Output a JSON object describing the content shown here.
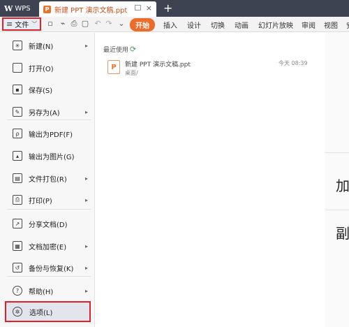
{
  "titlebar": {
    "app_label": "WPS",
    "document_tab": "新建 PPT 演示文稿.ppt",
    "ppt_badge": "P",
    "close": "×",
    "add_tab": "+"
  },
  "toolbar": {
    "file_label": "文件",
    "file_chevron": "﹀",
    "tabs": [
      "开始",
      "插入",
      "设计",
      "切换",
      "动画",
      "幻灯片放映",
      "审阅",
      "视图",
      "安"
    ]
  },
  "file_menu": {
    "items": [
      {
        "label": "新建(N)",
        "icon": "new-file-icon",
        "submenu": true
      },
      {
        "label": "打开(O)",
        "icon": "folder-open-icon",
        "submenu": false
      },
      {
        "label": "保存(S)",
        "icon": "save-icon",
        "submenu": false
      },
      {
        "label": "另存为(A)",
        "icon": "save-as-icon",
        "submenu": true
      },
      {
        "label": "输出为PDF(F)",
        "icon": "pdf-icon",
        "submenu": false
      },
      {
        "label": "输出为图片(G)",
        "icon": "image-icon",
        "submenu": false
      },
      {
        "label": "文件打包(R)",
        "icon": "package-icon",
        "submenu": true
      },
      {
        "label": "打印(P)",
        "icon": "printer-icon",
        "submenu": true
      },
      {
        "label": "分享文档(D)",
        "icon": "share-icon",
        "submenu": false
      },
      {
        "label": "文档加密(E)",
        "icon": "lock-icon",
        "submenu": true
      },
      {
        "label": "备份与恢复(K)",
        "icon": "backup-icon",
        "submenu": true
      },
      {
        "label": "帮助(H)",
        "icon": "help-icon",
        "submenu": true
      },
      {
        "label": "选项(L)",
        "icon": "gear-icon",
        "submenu": false
      }
    ],
    "arrow": "▸"
  },
  "recent": {
    "title": "最近使用",
    "files": [
      {
        "name": "新建 PPT 演示文稿.ppt",
        "path": "桌面/",
        "time": "今天 08:39",
        "icon": "P"
      }
    ]
  },
  "background": {
    "char1": "加",
    "char2": "副"
  }
}
